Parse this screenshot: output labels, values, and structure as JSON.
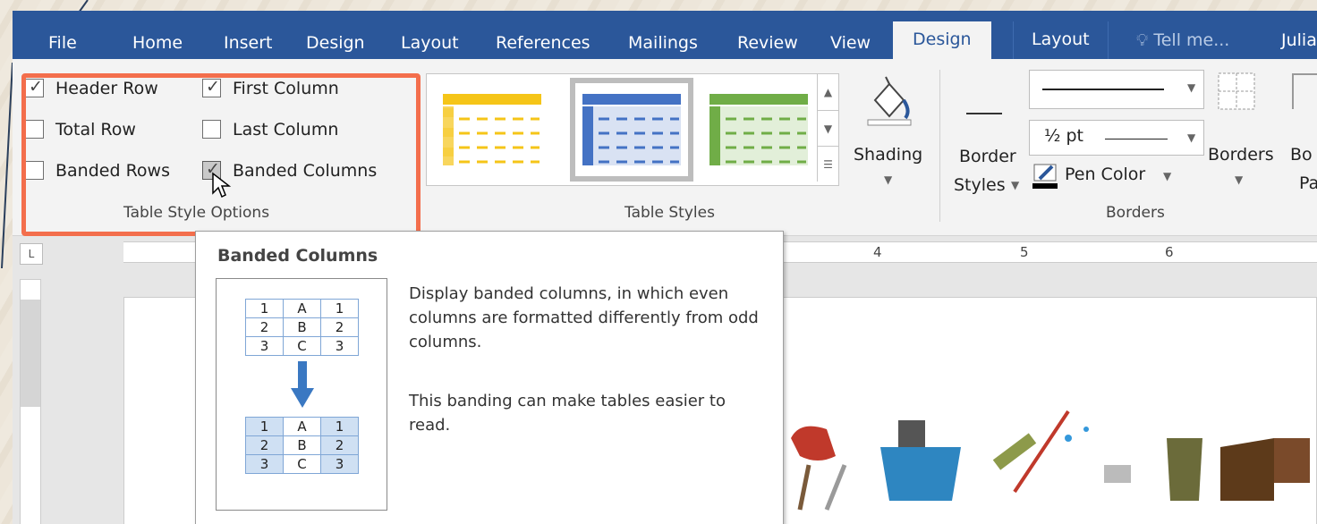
{
  "tabs": [
    {
      "label": "File"
    },
    {
      "label": "Home"
    },
    {
      "label": "Insert"
    },
    {
      "label": "Design"
    },
    {
      "label": "Layout"
    },
    {
      "label": "References"
    },
    {
      "label": "Mailings"
    },
    {
      "label": "Review"
    },
    {
      "label": "View"
    },
    {
      "label": "Design"
    },
    {
      "label": "Layout"
    }
  ],
  "tell_me": "Tell me...",
  "user_name": "Julia",
  "colors": {
    "accent": "#2b579a",
    "highlight": "#f36e4c",
    "band": "#cfe0f3"
  },
  "table_style_options": {
    "group_label": "Table Style Options",
    "items": [
      {
        "label": "Header Row",
        "checked": true
      },
      {
        "label": "First Column",
        "checked": true
      },
      {
        "label": "Total Row",
        "checked": false
      },
      {
        "label": "Last Column",
        "checked": false
      },
      {
        "label": "Banded Rows",
        "checked": false
      },
      {
        "label": "Banded Columns",
        "checked": true
      }
    ]
  },
  "table_styles": {
    "group_label": "Table Styles",
    "styles": [
      {
        "name": "yellow-style",
        "color": "#f5c518"
      },
      {
        "name": "blue-style",
        "color": "#4472c4"
      },
      {
        "name": "green-style",
        "color": "#70ad47"
      }
    ]
  },
  "shading": {
    "label": "Shading"
  },
  "borders": {
    "group_label": "Borders",
    "border_styles_line1": "Border",
    "border_styles_line2": "Styles",
    "weight": "½ pt",
    "pen_color": "Pen Color",
    "borders_label": "Borders",
    "painter_line1": "Bo",
    "painter_line2": "Pai"
  },
  "ruler": {
    "numbers": [
      "4",
      "5",
      "6"
    ]
  },
  "tooltip": {
    "title": "Banded Columns",
    "description": "Display banded columns, in which even columns are formatted differently from odd columns.",
    "note": "This banding can make tables easier to read.",
    "table_before": [
      [
        "1",
        "A",
        "1"
      ],
      [
        "2",
        "B",
        "2"
      ],
      [
        "3",
        "C",
        "3"
      ]
    ],
    "table_after": [
      [
        "1",
        "A",
        "1"
      ],
      [
        "2",
        "B",
        "2"
      ],
      [
        "3",
        "C",
        "3"
      ]
    ]
  }
}
